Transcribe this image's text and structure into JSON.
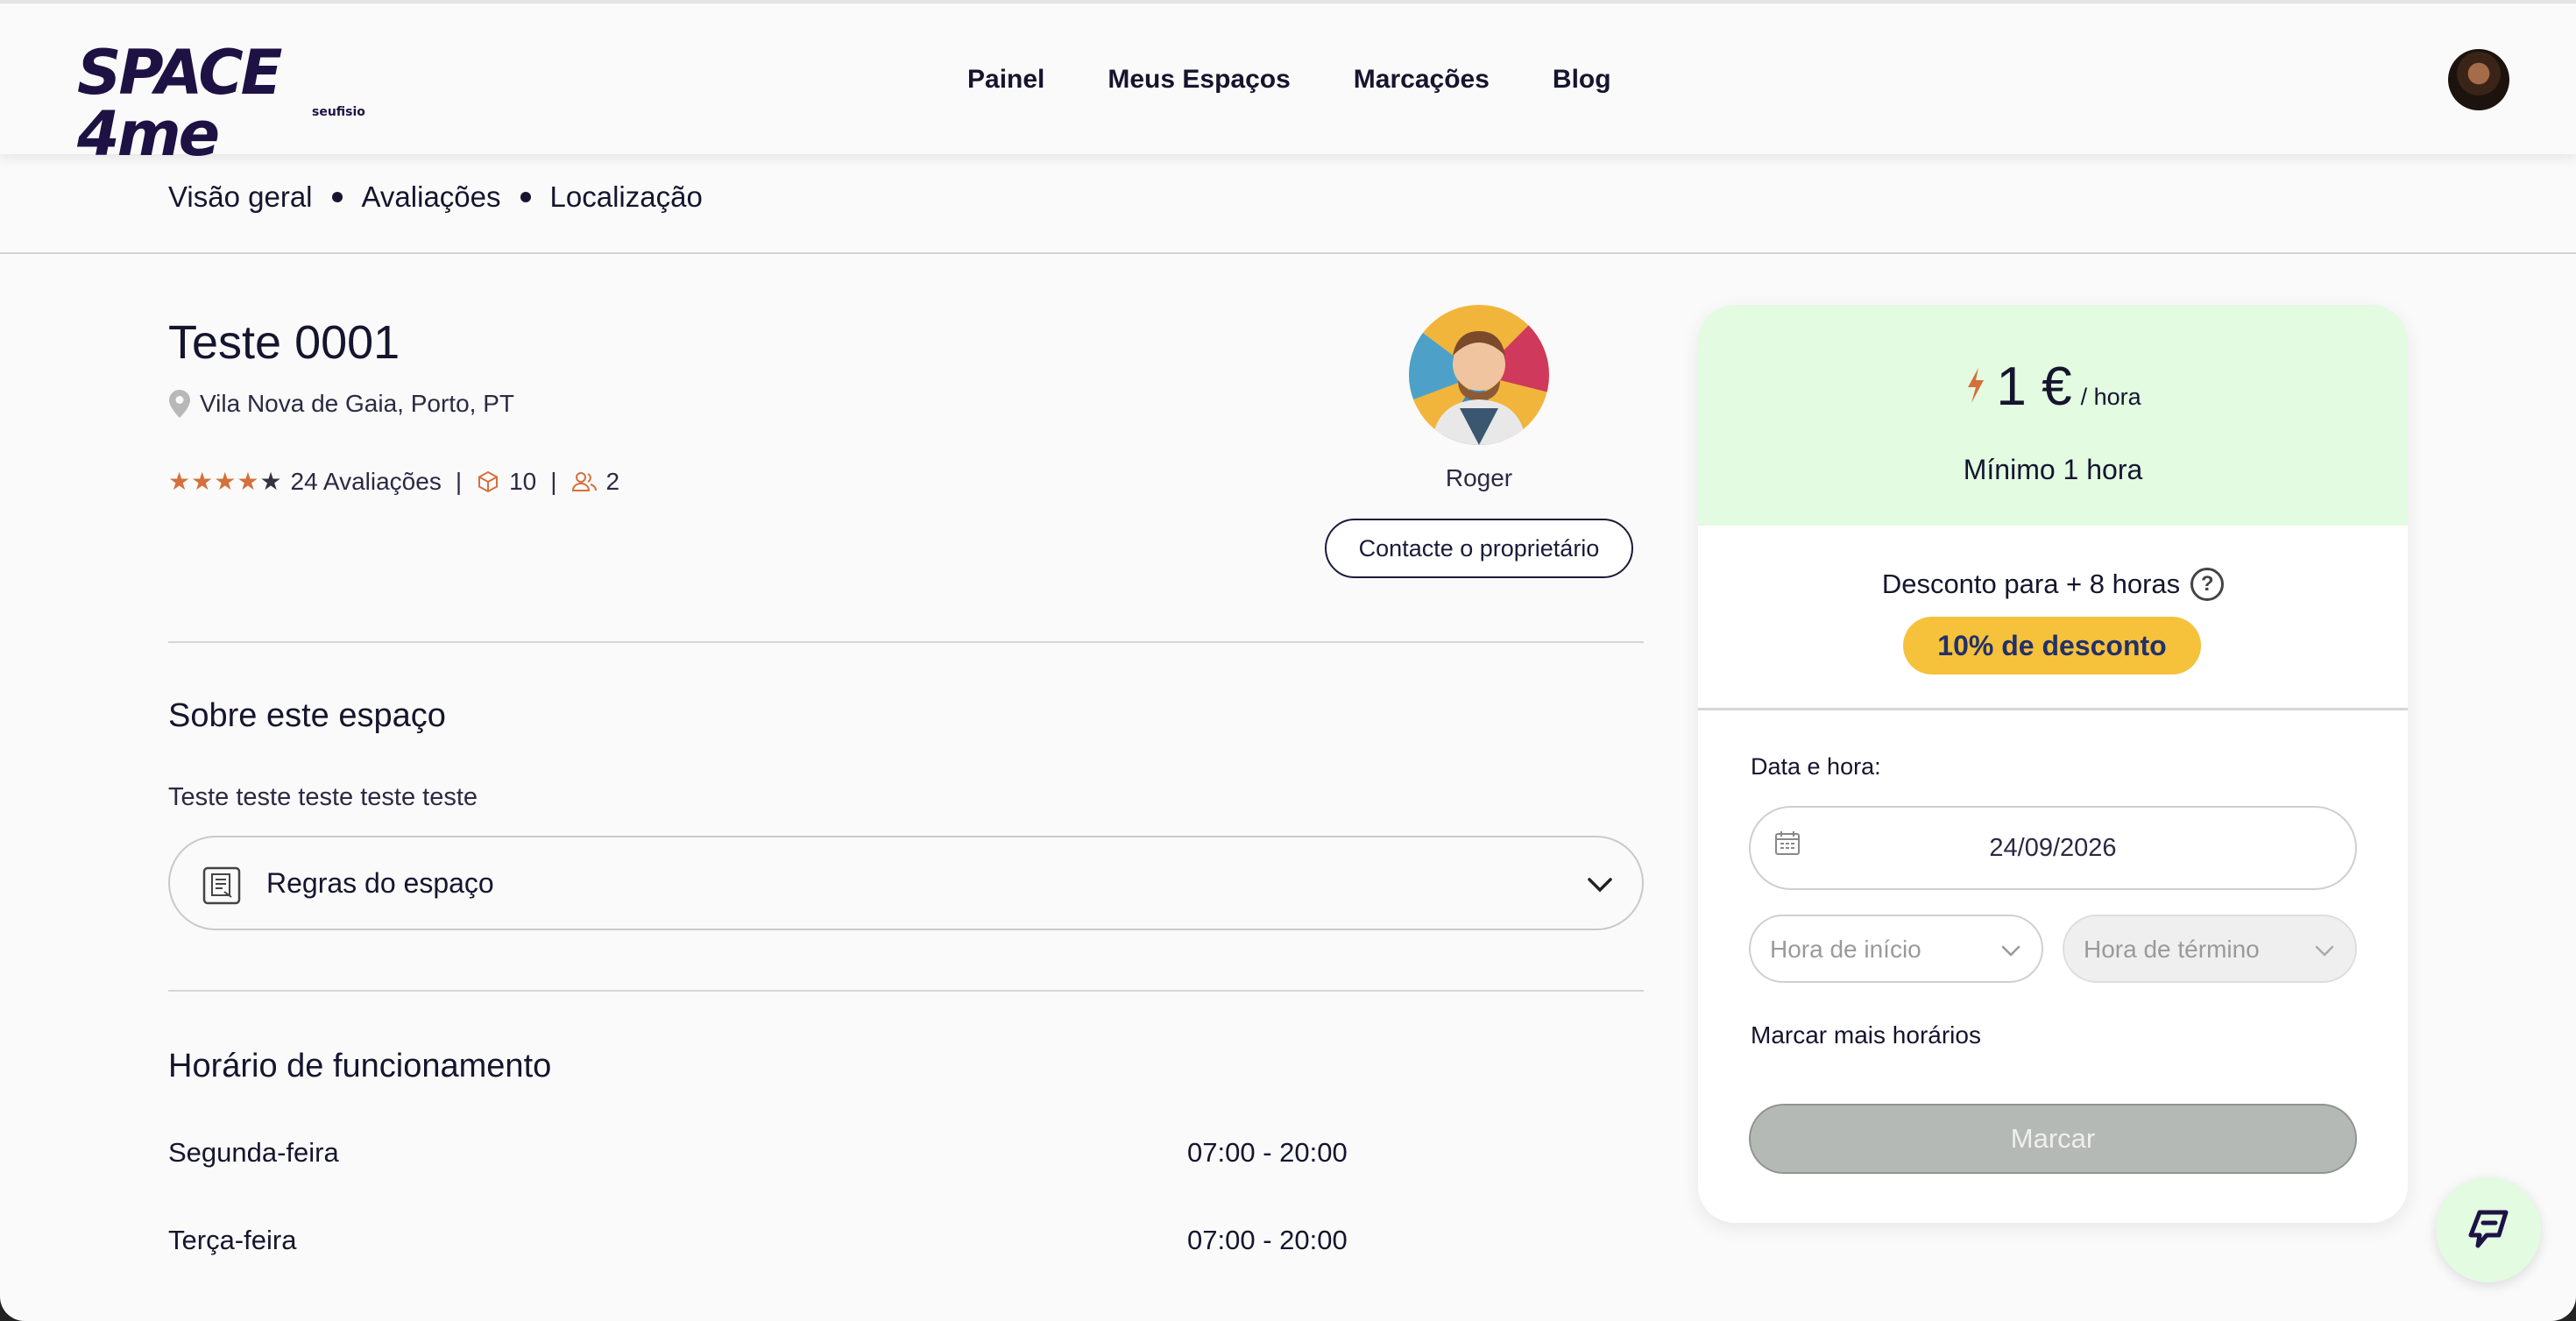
{
  "header": {
    "logo_text": "SPACE 4me",
    "logo_subtext": "seufisio",
    "nav": [
      {
        "label": "Painel"
      },
      {
        "label": "Meus Espaços"
      },
      {
        "label": "Marcações"
      },
      {
        "label": "Blog"
      }
    ],
    "user_avatar_icon": "user-avatar"
  },
  "subnav": {
    "links": [
      {
        "label": "Visão geral"
      },
      {
        "label": "Avaliações"
      },
      {
        "label": "Localização"
      }
    ]
  },
  "space": {
    "title": "Teste 0001",
    "location": "Vila Nova de Gaia, Porto, PT",
    "rating": 4,
    "rating_max": 5,
    "reviews_label": "24 Avaliações",
    "rooms_count": "10",
    "capacity_count": "2"
  },
  "owner": {
    "name": "Roger",
    "contact_label": "Contacte o proprietário"
  },
  "about": {
    "title": "Sobre este espaço",
    "description": "Teste teste teste teste teste",
    "rules_label": "Regras do espaço"
  },
  "hours": {
    "title": "Horário de funcionamento",
    "rows": [
      {
        "day": "Segunda-feira",
        "time": "07:00 - 20:00"
      },
      {
        "day": "Terça-feira",
        "time": "07:00 - 20:00"
      }
    ]
  },
  "booking": {
    "price": "1 €",
    "price_unit": "/ hora",
    "minimum": "Mínimo 1 hora",
    "discount_text": "Desconto para + 8 horas",
    "discount_badge": "10% de desconto",
    "date_label": "Data e hora:",
    "date_value": "24/09/2026",
    "start_placeholder": "Hora de início",
    "end_placeholder": "Hora de término",
    "more_times": "Marcar mais horários",
    "book_label": "Marcar"
  },
  "colors": {
    "accent_green": "#e2fbe1",
    "badge_yellow": "#f6c13b",
    "star_orange": "#d4703c",
    "text_dark": "#15152e"
  }
}
